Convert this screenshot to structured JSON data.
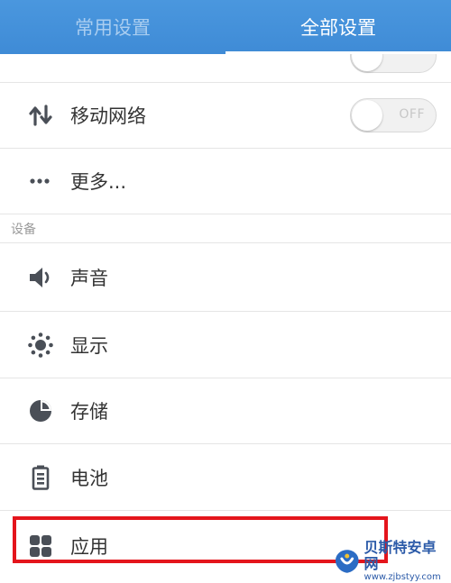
{
  "tabs": [
    {
      "label": "常用设置",
      "active": false
    },
    {
      "label": "全部设置",
      "active": true
    }
  ],
  "rows_top": [
    {
      "label": "移动网络",
      "icon": "mobile-data-arrows-icon",
      "toggle": "OFF"
    },
    {
      "label": "更多...",
      "icon": "more-dots-icon"
    }
  ],
  "section_device": "设备",
  "rows_device": [
    {
      "label": "声音",
      "icon": "speaker-icon"
    },
    {
      "label": "显示",
      "icon": "brightness-sun-icon"
    },
    {
      "label": "存储",
      "icon": "storage-pie-icon"
    },
    {
      "label": "电池",
      "icon": "battery-icon"
    },
    {
      "label": "应用",
      "icon": "apps-grid-icon"
    }
  ],
  "watermark": {
    "title": "贝斯特安卓网",
    "url": "www.zjbstyy.com"
  },
  "colors": {
    "header": "#4a97de",
    "highlight": "#e4151c",
    "icon": "#4a4f57"
  }
}
